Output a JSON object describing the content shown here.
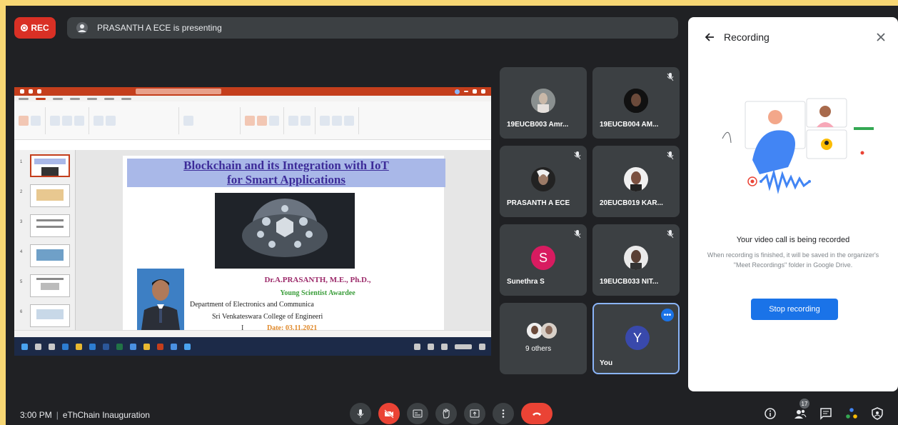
{
  "header": {
    "rec_label": "REC",
    "presenting_text": "PRASANTH A ECE is presenting"
  },
  "slide": {
    "title_line1": "Blockchain and its Integration with IoT",
    "title_line2": "for Smart Applications",
    "speaker_name": "Dr.A.PRASANTH, M.E., Ph.D.,",
    "award": "Young Scientist Awardee",
    "department": "Department of Electronics and Communica",
    "college": "Sri Venkateswara College of Engineeri",
    "page_marker": "I",
    "date": "Date: 03.11.2021"
  },
  "participants": [
    {
      "name": "19EUCB003 Amr...",
      "muted": false
    },
    {
      "name": "19EUCB004 AM...",
      "muted": true
    },
    {
      "name": "PRASANTH A ECE",
      "muted": true
    },
    {
      "name": "20EUCB019 KAR...",
      "muted": true
    },
    {
      "name": "Sunethra S",
      "initial": "S",
      "muted": true
    },
    {
      "name": "19EUCB033 NIT...",
      "muted": true
    },
    {
      "name": "9 others"
    },
    {
      "name": "You",
      "initial": "Y"
    }
  ],
  "panel": {
    "title": "Recording",
    "headline": "Your video call is being recorded",
    "description": "When recording is finished, it will be saved in the organizer's \"Meet Recordings\" folder in Google Drive.",
    "stop_button": "Stop recording"
  },
  "bottom": {
    "time": "3:00 PM",
    "meeting_name": "eThChain Inauguration",
    "participant_badge": "17"
  },
  "colors": {
    "rec_red": "#d93025",
    "accent_blue": "#1a73e8",
    "dark_bg": "#202124",
    "tile_bg": "#3c4043",
    "frame_border": "#f7d774"
  }
}
